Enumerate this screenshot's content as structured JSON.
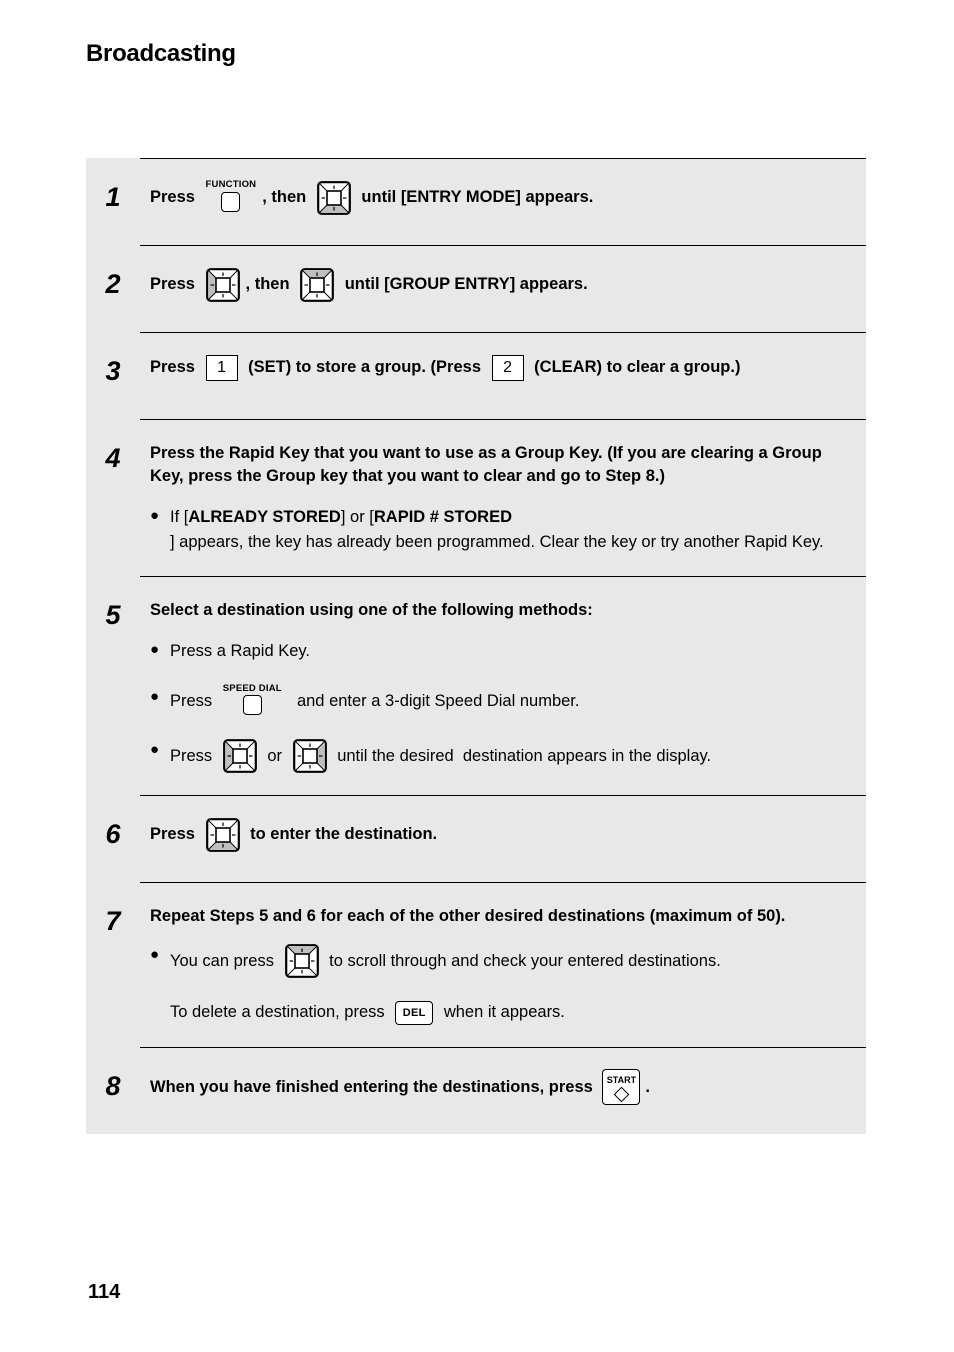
{
  "document": {
    "title": "Broadcasting",
    "page_number": "114"
  },
  "colors": {
    "panel_background": "#e8e8e8",
    "page_background": "#ffffff",
    "text": "#000000",
    "key_face_shading": "#bfbfbf"
  },
  "steps": [
    {
      "number": "1",
      "segments": [
        {
          "type": "text",
          "value": "Press "
        },
        {
          "type": "labeled_key",
          "label": "FUNCTION",
          "icon": "function-key-icon"
        },
        {
          "type": "text",
          "value": ", then "
        },
        {
          "type": "nav_key",
          "direction": "down",
          "icon": "nav-key-down-icon"
        },
        {
          "type": "text",
          "value": " until [ENTRY MODE] appears."
        }
      ]
    },
    {
      "number": "2",
      "segments": [
        {
          "type": "text",
          "value": "Press "
        },
        {
          "type": "nav_key",
          "direction": "left",
          "icon": "nav-key-left-icon"
        },
        {
          "type": "text",
          "value": ", then "
        },
        {
          "type": "nav_key",
          "direction": "up",
          "icon": "nav-key-up-icon"
        },
        {
          "type": "text",
          "value": " until [GROUP ENTRY] appears."
        }
      ]
    },
    {
      "number": "3",
      "segments": [
        {
          "type": "text",
          "value": "Press "
        },
        {
          "type": "digit_key",
          "label": "1",
          "icon": "digit-key-1-icon"
        },
        {
          "type": "text",
          "value": " (SET) to store a group. (Press "
        },
        {
          "type": "digit_key",
          "label": "2",
          "icon": "digit-key-2-icon"
        },
        {
          "type": "text",
          "value": " (CLEAR) to clear a group.)"
        }
      ]
    },
    {
      "number": "4",
      "paragraph": "Press the Rapid Key that you want to use as a Group Key. (If you are clearing a Group Key, press the Group key that you want to clear and go to Step 8.)",
      "bullets": [
        {
          "segments": [
            {
              "type": "text",
              "value": "If ["
            },
            {
              "type": "bold",
              "value": "ALREADY STORED"
            },
            {
              "type": "text",
              "value": "] or ["
            },
            {
              "type": "bold",
              "value": "RAPID # STORED"
            },
            {
              "type": "text",
              "value": "] appears, the key has already been programmed. Clear the key or try another Rapid Key."
            }
          ]
        }
      ]
    },
    {
      "number": "5",
      "paragraph": "Select a destination using one of the following methods:",
      "bullets": [
        {
          "segments": [
            {
              "type": "text",
              "value": "Press a Rapid Key."
            }
          ]
        },
        {
          "segments": [
            {
              "type": "text",
              "value": "Press "
            },
            {
              "type": "labeled_key",
              "label": "SPEED DIAL",
              "icon": "speed-dial-key-icon"
            },
            {
              "type": "text",
              "value": "  and enter a 3-digit Speed Dial number."
            }
          ]
        },
        {
          "segments": [
            {
              "type": "text",
              "value": "Press "
            },
            {
              "type": "nav_key",
              "direction": "left",
              "icon": "nav-key-left-icon"
            },
            {
              "type": "text",
              "value": " or "
            },
            {
              "type": "nav_key",
              "direction": "right",
              "icon": "nav-key-right-icon"
            },
            {
              "type": "text",
              "value": " until the desired  destination appears in the display."
            }
          ]
        }
      ]
    },
    {
      "number": "6",
      "segments": [
        {
          "type": "text",
          "value": "Press "
        },
        {
          "type": "nav_key",
          "direction": "down",
          "icon": "nav-key-down-icon"
        },
        {
          "type": "text",
          "value": " to enter the destination."
        }
      ]
    },
    {
      "number": "7",
      "paragraph": "Repeat Steps 5 and 6 for each of the other desired destinations (maximum of 50).",
      "bullets": [
        {
          "segments": [
            {
              "type": "text",
              "value": "You can press "
            },
            {
              "type": "nav_key",
              "direction": "up",
              "icon": "nav-key-up-icon"
            },
            {
              "type": "text",
              "value": " to scroll through and check your entered destinations."
            }
          ]
        },
        {
          "no_dot": true,
          "segments": [
            {
              "type": "text",
              "value": "To delete a destination, press "
            },
            {
              "type": "del_key",
              "label": "DEL",
              "icon": "del-key-icon"
            },
            {
              "type": "text",
              "value": " when it appears."
            }
          ]
        }
      ]
    },
    {
      "number": "8",
      "segments": [
        {
          "type": "text",
          "value": "When you have finished entering the destinations, press "
        },
        {
          "type": "start_key",
          "label": "START",
          "icon": "start-key-icon"
        },
        {
          "type": "text",
          "value": "."
        }
      ]
    }
  ]
}
